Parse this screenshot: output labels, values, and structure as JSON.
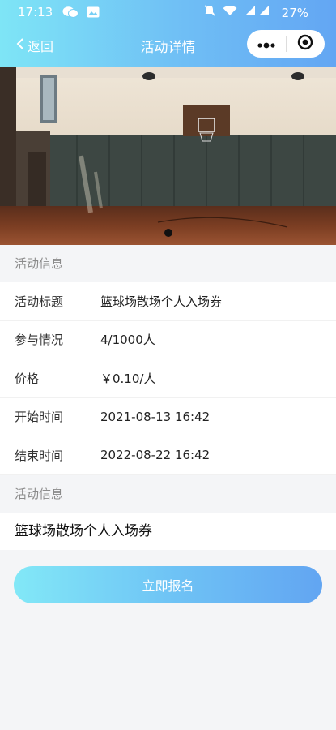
{
  "status": {
    "time": "17:13",
    "battery": "27%"
  },
  "nav": {
    "back_label": "返回",
    "title": "活动详情"
  },
  "sections": {
    "info_title": "活动信息",
    "desc_title": "活动信息"
  },
  "details": [
    {
      "label": "活动标题",
      "value": "篮球场散场个人入场券"
    },
    {
      "label": "参与情况",
      "value": "4/1000人"
    },
    {
      "label": "价格",
      "value": "￥0.10/人"
    },
    {
      "label": "开始时间",
      "value": "2021-08-13 16:42"
    },
    {
      "label": "结束时间",
      "value": "2022-08-22 16:42"
    }
  ],
  "description": "篮球场散场个人入场券",
  "actions": {
    "signup_label": "立即报名"
  },
  "colors": {
    "accent_start": "#82e8f7",
    "accent_end": "#62a5f2"
  },
  "icons": [
    "wechat-icon",
    "gallery-icon",
    "mute-icon",
    "wifi-icon",
    "signal-icon",
    "chevron-left-icon",
    "more-icon",
    "record-icon"
  ]
}
